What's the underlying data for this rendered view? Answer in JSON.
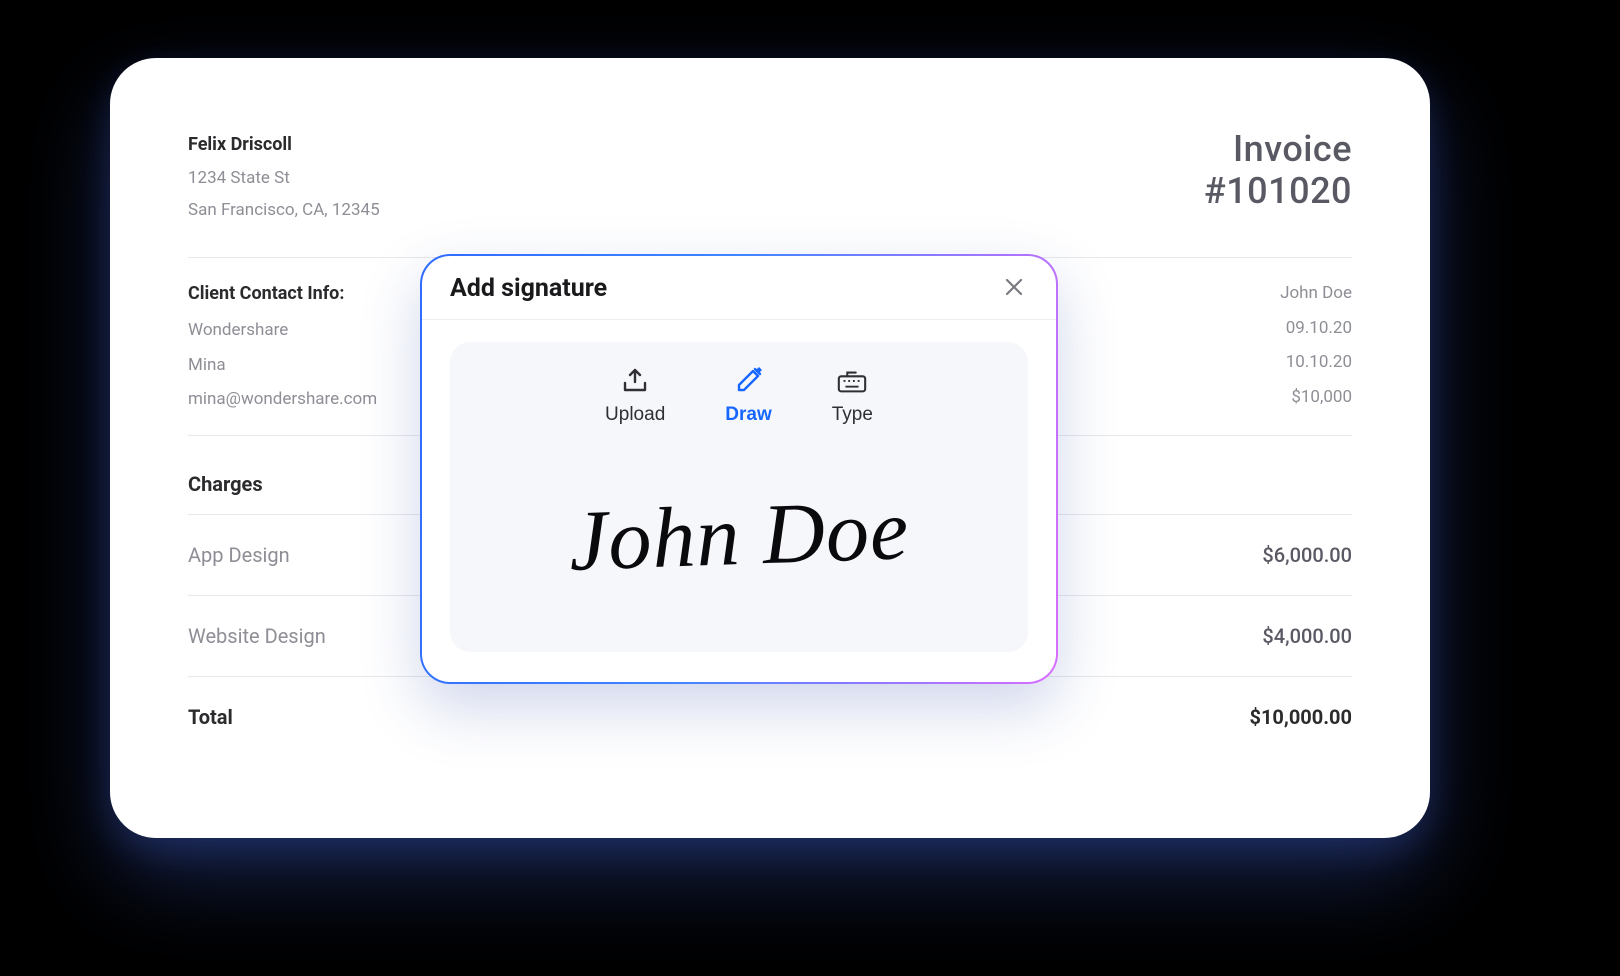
{
  "sender": {
    "name": "Felix Driscoll",
    "address1": "1234 State St",
    "address2": "San Francisco, CA, 12345"
  },
  "invoice": {
    "label": "Invoice",
    "number": "#101020"
  },
  "client": {
    "title": "Client Contact Info:",
    "company": "Wondershare",
    "contact": "Mina",
    "email": "mina@wondershare.com"
  },
  "meta": {
    "name": "John Doe",
    "date1": "09.10.20",
    "date2": "10.10.20",
    "amount": "$10,000"
  },
  "charges": {
    "title": "Charges",
    "items": [
      {
        "label": "App Design",
        "value": "$6,000.00"
      },
      {
        "label": "Website Design",
        "value": "$4,000.00"
      }
    ],
    "total_label": "Total",
    "total_value": "$10,000.00"
  },
  "modal": {
    "title": "Add signature",
    "tabs": {
      "upload": "Upload",
      "draw": "Draw",
      "type": "Type"
    },
    "signature_text": "John Doe"
  }
}
